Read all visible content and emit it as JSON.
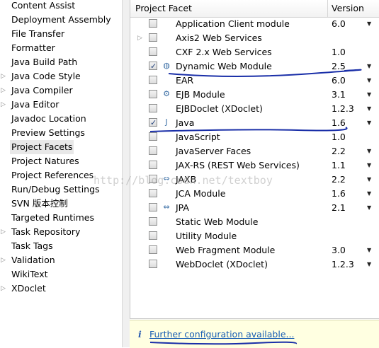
{
  "left_nav": {
    "items": [
      {
        "label": "Content Assist",
        "expandable": false,
        "selected": false
      },
      {
        "label": "Deployment Assembly",
        "expandable": false,
        "selected": false
      },
      {
        "label": "File Transfer",
        "expandable": false,
        "selected": false
      },
      {
        "label": "Formatter",
        "expandable": false,
        "selected": false
      },
      {
        "label": "Java Build Path",
        "expandable": false,
        "selected": false
      },
      {
        "label": "Java Code Style",
        "expandable": true,
        "selected": false
      },
      {
        "label": "Java Compiler",
        "expandable": true,
        "selected": false
      },
      {
        "label": "Java Editor",
        "expandable": true,
        "selected": false
      },
      {
        "label": "Javadoc Location",
        "expandable": false,
        "selected": false
      },
      {
        "label": "Preview Settings",
        "expandable": false,
        "selected": false
      },
      {
        "label": "Project Facets",
        "expandable": false,
        "selected": true
      },
      {
        "label": "Project Natures",
        "expandable": false,
        "selected": false
      },
      {
        "label": "Project References",
        "expandable": false,
        "selected": false
      },
      {
        "label": "Run/Debug Settings",
        "expandable": false,
        "selected": false
      },
      {
        "label": "SVN 版本控制",
        "expandable": false,
        "selected": false
      },
      {
        "label": "Targeted Runtimes",
        "expandable": false,
        "selected": false
      },
      {
        "label": "Task Repository",
        "expandable": true,
        "selected": false
      },
      {
        "label": "Task Tags",
        "expandable": false,
        "selected": false
      },
      {
        "label": "Validation",
        "expandable": true,
        "selected": false
      },
      {
        "label": "WikiText",
        "expandable": false,
        "selected": false
      },
      {
        "label": "XDoclet",
        "expandable": true,
        "selected": false
      }
    ]
  },
  "facets": {
    "col_facet": "Project Facet",
    "col_version": "Version",
    "rows": [
      {
        "name": "Application Client module",
        "version": "6.0",
        "checked": false,
        "has_dropdown": true,
        "expandable": false,
        "icon": ""
      },
      {
        "name": "Axis2 Web Services",
        "version": "",
        "checked": false,
        "has_dropdown": false,
        "expandable": true,
        "icon": ""
      },
      {
        "name": "CXF 2.x Web Services",
        "version": "1.0",
        "checked": false,
        "has_dropdown": false,
        "expandable": false,
        "icon": ""
      },
      {
        "name": "Dynamic Web Module",
        "version": "2.5",
        "checked": true,
        "has_dropdown": true,
        "expandable": false,
        "icon": "◍"
      },
      {
        "name": "EAR",
        "version": "6.0",
        "checked": false,
        "has_dropdown": true,
        "expandable": false,
        "icon": ""
      },
      {
        "name": "EJB Module",
        "version": "3.1",
        "checked": false,
        "has_dropdown": true,
        "expandable": false,
        "icon": "⚙"
      },
      {
        "name": "EJBDoclet (XDoclet)",
        "version": "1.2.3",
        "checked": false,
        "has_dropdown": true,
        "expandable": false,
        "icon": ""
      },
      {
        "name": "Java",
        "version": "1.6",
        "checked": true,
        "has_dropdown": true,
        "expandable": false,
        "icon": "J"
      },
      {
        "name": "JavaScript",
        "version": "1.0",
        "checked": false,
        "has_dropdown": false,
        "expandable": false,
        "icon": ""
      },
      {
        "name": "JavaServer Faces",
        "version": "2.2",
        "checked": false,
        "has_dropdown": true,
        "expandable": false,
        "icon": ""
      },
      {
        "name": "JAX-RS (REST Web Services)",
        "version": "1.1",
        "checked": false,
        "has_dropdown": true,
        "expandable": false,
        "icon": ""
      },
      {
        "name": "JAXB",
        "version": "2.2",
        "checked": false,
        "has_dropdown": true,
        "expandable": false,
        "icon": "⇔"
      },
      {
        "name": "JCA Module",
        "version": "1.6",
        "checked": false,
        "has_dropdown": true,
        "expandable": false,
        "icon": ""
      },
      {
        "name": "JPA",
        "version": "2.1",
        "checked": false,
        "has_dropdown": true,
        "expandable": false,
        "icon": "⇔"
      },
      {
        "name": "Static Web Module",
        "version": "",
        "checked": false,
        "has_dropdown": false,
        "expandable": false,
        "icon": ""
      },
      {
        "name": "Utility Module",
        "version": "",
        "checked": false,
        "has_dropdown": false,
        "expandable": false,
        "icon": ""
      },
      {
        "name": "Web Fragment Module",
        "version": "3.0",
        "checked": false,
        "has_dropdown": true,
        "expandable": false,
        "icon": ""
      },
      {
        "name": "WebDoclet (XDoclet)",
        "version": "1.2.3",
        "checked": false,
        "has_dropdown": true,
        "expandable": false,
        "icon": ""
      }
    ]
  },
  "info": {
    "icon": "i",
    "link_text": "Further configuration available..."
  },
  "watermark": "http://blog.csdn.net/textboy",
  "colors": {
    "annotation": "#1a2fa8",
    "link": "#1a5fb4",
    "info_bg": "#ffffe1"
  }
}
